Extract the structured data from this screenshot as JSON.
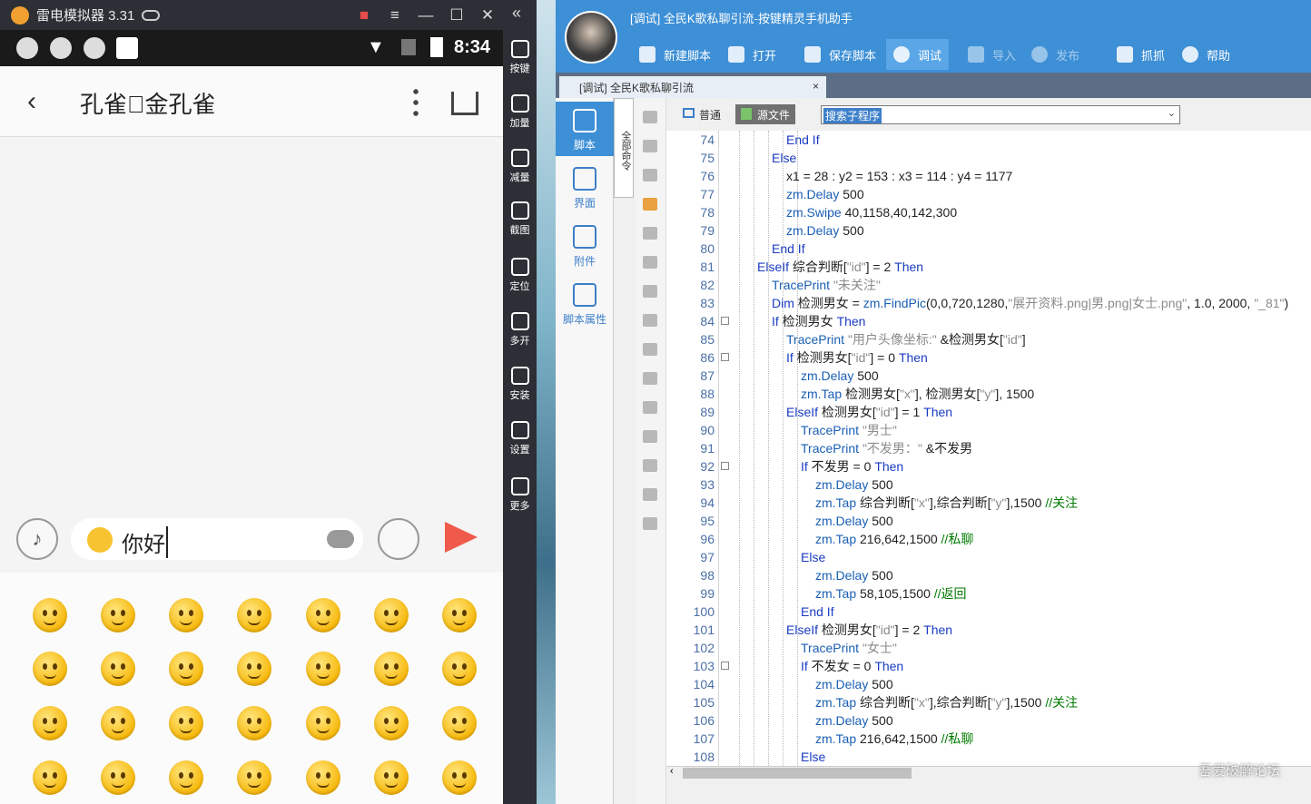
{
  "emulator": {
    "title": "雷电模拟器 3.31",
    "clock": "8:34",
    "contact_name": "孔雀\u0000金孔雀",
    "message_text": "你好",
    "sidebar": [
      "按键",
      "加量",
      "减量",
      "截图",
      "定位",
      "多开",
      "安装",
      "设置",
      "更多"
    ]
  },
  "ide": {
    "window_title": "[调试] 全民K歌私聊引流-按键精灵手机助手",
    "toolbar": {
      "new": "新建脚本",
      "open": "打开",
      "save": "保存脚本",
      "debug": "调试",
      "import": "导入",
      "publish": "发布",
      "capture": "抓抓",
      "help": "帮助"
    },
    "doc_tab": "[调试] 全民K歌私聊引流",
    "nav": [
      "脚本",
      "界面",
      "附件",
      "脚本属性"
    ],
    "vertical_cmd": "全部命令",
    "mode_normal": "普通",
    "mode_source": "源文件",
    "search_placeholder": "搜索子程序",
    "code": [
      {
        "n": "74",
        "ind": 3,
        "t": [
          [
            "kw",
            "End If"
          ]
        ]
      },
      {
        "n": "75",
        "ind": 2,
        "t": [
          [
            "kw",
            "Else"
          ]
        ]
      },
      {
        "n": "76",
        "ind": 3,
        "t": [
          [
            "",
            "x1 = 28 : y2 = 153 : x3 = 114 : y4 = 1177"
          ]
        ]
      },
      {
        "n": "77",
        "ind": 3,
        "t": [
          [
            "fn",
            "zm.Delay"
          ],
          [
            "",
            " 500"
          ]
        ]
      },
      {
        "n": "78",
        "ind": 3,
        "t": [
          [
            "fn",
            "zm.Swipe"
          ],
          [
            "",
            " 40,1158,40,142,300"
          ]
        ]
      },
      {
        "n": "79",
        "ind": 3,
        "t": [
          [
            "fn",
            "zm.Delay"
          ],
          [
            "",
            " 500"
          ]
        ]
      },
      {
        "n": "80",
        "ind": 2,
        "t": [
          [
            "kw",
            "End If"
          ]
        ]
      },
      {
        "n": "81",
        "ind": 1,
        "t": [
          [
            "kw",
            "ElseIf"
          ],
          [
            "",
            " 综合判断["
          ],
          [
            "str",
            "\"id\""
          ],
          [
            "",
            "] = 2 "
          ],
          [
            "kw",
            "Then"
          ]
        ]
      },
      {
        "n": "82",
        "ind": 2,
        "t": [
          [
            "fn",
            "TracePrint"
          ],
          [
            "str",
            " \"未关注\""
          ]
        ]
      },
      {
        "n": "83",
        "ind": 2,
        "t": [
          [
            "kw",
            "Dim"
          ],
          [
            "",
            " 检测男女 = "
          ],
          [
            "fn",
            "zm.FindPic"
          ],
          [
            "",
            "(0,0,720,1280,"
          ],
          [
            "str",
            "\"展开资料.png|男.png|女士.png\""
          ],
          [
            "",
            ", 1.0, 2000, "
          ],
          [
            "str",
            "\"_81\""
          ],
          [
            "",
            ")"
          ]
        ]
      },
      {
        "n": "84",
        "ind": 2,
        "fold": 1,
        "t": [
          [
            "kw",
            "If"
          ],
          [
            "",
            " 检测男女 "
          ],
          [
            "kw",
            "Then"
          ]
        ]
      },
      {
        "n": "85",
        "ind": 3,
        "t": [
          [
            "fn",
            "TracePrint"
          ],
          [
            "str",
            " \"用户头像坐标:\""
          ],
          [
            "",
            " &检测男女["
          ],
          [
            "str",
            "\"id\""
          ],
          [
            "",
            "]"
          ]
        ]
      },
      {
        "n": "86",
        "ind": 3,
        "fold": 1,
        "t": [
          [
            "kw",
            "If"
          ],
          [
            "",
            " 检测男女["
          ],
          [
            "str",
            "\"id\""
          ],
          [
            "",
            "] = 0 "
          ],
          [
            "kw",
            "Then"
          ]
        ]
      },
      {
        "n": "87",
        "ind": 4,
        "t": [
          [
            "fn",
            "zm.Delay"
          ],
          [
            "",
            " 500"
          ]
        ]
      },
      {
        "n": "88",
        "ind": 4,
        "t": [
          [
            "fn",
            "zm.Tap"
          ],
          [
            "",
            " 检测男女["
          ],
          [
            "str",
            "\"x\""
          ],
          [
            "",
            "], 检测男女["
          ],
          [
            "str",
            "\"y\""
          ],
          [
            "",
            "], 1500"
          ]
        ]
      },
      {
        "n": "89",
        "ind": 3,
        "t": [
          [
            "kw",
            "ElseIf"
          ],
          [
            "",
            " 检测男女["
          ],
          [
            "str",
            "\"id\""
          ],
          [
            "",
            "] = 1 "
          ],
          [
            "kw",
            "Then"
          ]
        ]
      },
      {
        "n": "90",
        "ind": 4,
        "t": [
          [
            "fn",
            "TracePrint"
          ],
          [
            "str",
            " \"男士\""
          ]
        ]
      },
      {
        "n": "91",
        "ind": 4,
        "t": [
          [
            "fn",
            "TracePrint"
          ],
          [
            "str",
            " \"不发男：\""
          ],
          [
            "",
            " &不发男"
          ]
        ]
      },
      {
        "n": "92",
        "ind": 4,
        "fold": 1,
        "t": [
          [
            "kw",
            "If"
          ],
          [
            "",
            " 不发男 = 0 "
          ],
          [
            "kw",
            "Then"
          ]
        ]
      },
      {
        "n": "93",
        "ind": 5,
        "t": [
          [
            "fn",
            "zm.Delay"
          ],
          [
            "",
            " 500"
          ]
        ]
      },
      {
        "n": "94",
        "ind": 5,
        "t": [
          [
            "fn",
            "zm.Tap"
          ],
          [
            "",
            " 综合判断["
          ],
          [
            "str",
            "\"x\""
          ],
          [
            "",
            "],综合判断["
          ],
          [
            "str",
            "\"y\""
          ],
          [
            "",
            "],1500 "
          ],
          [
            "cm",
            "//关注"
          ]
        ]
      },
      {
        "n": "95",
        "ind": 5,
        "t": [
          [
            "fn",
            "zm.Delay"
          ],
          [
            "",
            " 500"
          ]
        ]
      },
      {
        "n": "96",
        "ind": 5,
        "t": [
          [
            "fn",
            "zm.Tap"
          ],
          [
            "",
            " 216,642,1500 "
          ],
          [
            "cm",
            "//私聊"
          ]
        ]
      },
      {
        "n": "97",
        "ind": 4,
        "t": [
          [
            "kw",
            "Else"
          ]
        ]
      },
      {
        "n": "98",
        "ind": 5,
        "t": [
          [
            "fn",
            "zm.Delay"
          ],
          [
            "",
            " 500"
          ]
        ]
      },
      {
        "n": "99",
        "ind": 5,
        "t": [
          [
            "fn",
            "zm.Tap"
          ],
          [
            "",
            " 58,105,1500 "
          ],
          [
            "cm",
            "//返回"
          ]
        ]
      },
      {
        "n": "100",
        "ind": 4,
        "t": [
          [
            "kw",
            "End If"
          ]
        ]
      },
      {
        "n": "101",
        "ind": 3,
        "t": [
          [
            "kw",
            "ElseIf"
          ],
          [
            "",
            " 检测男女["
          ],
          [
            "str",
            "\"id\""
          ],
          [
            "",
            "] = 2 "
          ],
          [
            "kw",
            "Then"
          ]
        ]
      },
      {
        "n": "102",
        "ind": 4,
        "t": [
          [
            "fn",
            "TracePrint"
          ],
          [
            "str",
            " \"女士\""
          ]
        ]
      },
      {
        "n": "103",
        "ind": 4,
        "fold": 1,
        "t": [
          [
            "kw",
            "If"
          ],
          [
            "",
            " 不发女 = 0 "
          ],
          [
            "kw",
            "Then"
          ]
        ]
      },
      {
        "n": "104",
        "ind": 5,
        "t": [
          [
            "fn",
            "zm.Delay"
          ],
          [
            "",
            " 500"
          ]
        ]
      },
      {
        "n": "105",
        "ind": 5,
        "t": [
          [
            "fn",
            "zm.Tap"
          ],
          [
            "",
            " 综合判断["
          ],
          [
            "str",
            "\"x\""
          ],
          [
            "",
            "],综合判断["
          ],
          [
            "str",
            "\"y\""
          ],
          [
            "",
            "],1500 "
          ],
          [
            "cm",
            "//关注"
          ]
        ]
      },
      {
        "n": "106",
        "ind": 5,
        "t": [
          [
            "fn",
            "zm.Delay"
          ],
          [
            "",
            " 500"
          ]
        ]
      },
      {
        "n": "107",
        "ind": 5,
        "t": [
          [
            "fn",
            "zm.Tap"
          ],
          [
            "",
            " 216,642,1500 "
          ],
          [
            "cm",
            "//私聊"
          ]
        ]
      },
      {
        "n": "108",
        "ind": 4,
        "t": [
          [
            "kw",
            "Else"
          ]
        ]
      }
    ]
  },
  "watermark": "吾爱破解论坛"
}
